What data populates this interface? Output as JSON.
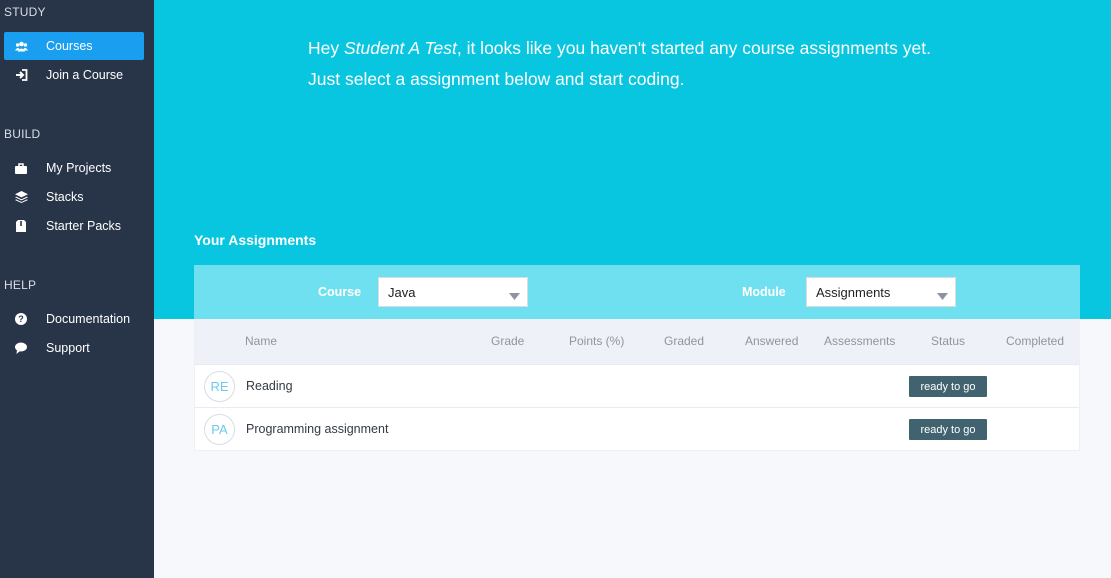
{
  "sidebar": {
    "sections": [
      {
        "title": "STUDY"
      },
      {
        "title": "BUILD"
      },
      {
        "title": "HELP"
      }
    ],
    "items": [
      {
        "label": "Courses",
        "icon": "users-icon",
        "active": true
      },
      {
        "label": "Join a Course",
        "icon": "sign-in-icon"
      },
      {
        "label": "My Projects",
        "icon": "briefcase-icon"
      },
      {
        "label": "Stacks",
        "icon": "layers-icon"
      },
      {
        "label": "Starter Packs",
        "icon": "package-icon"
      },
      {
        "label": "Documentation",
        "icon": "question-circle-icon"
      },
      {
        "label": "Support",
        "icon": "speech-bubble-icon"
      }
    ]
  },
  "hero": {
    "greeting_prefix": "Hey ",
    "user_name": "Student A Test",
    "greeting_suffix": ", it looks like you haven't started any course assignments yet.",
    "line2": "Just select a assignment below and start coding."
  },
  "assignments": {
    "title": "Your Assignments",
    "filters": {
      "course_label": "Course",
      "course_value": "Java",
      "module_label": "Module",
      "module_value": "Assignments"
    },
    "columns": [
      "Name",
      "Grade",
      "Points (%)",
      "Graded",
      "Answered",
      "Assessments",
      "Status",
      "Completed"
    ],
    "rows": [
      {
        "initials": "RE",
        "name": "Reading",
        "status": "ready to go"
      },
      {
        "initials": "PA",
        "name": "Programming assignment",
        "status": "ready to go"
      }
    ]
  },
  "colors": {
    "sidebar_bg": "#283447",
    "active_item": "#1a9ff0",
    "hero_bg": "#08c6df",
    "filter_bar_bg": "#6fe0ef",
    "status_badge": "#41636f"
  }
}
